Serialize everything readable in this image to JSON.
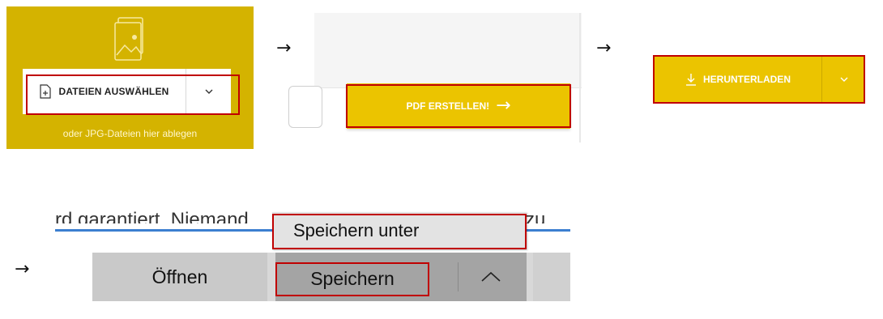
{
  "arrows": {
    "symbol": "→"
  },
  "panel1": {
    "select_button_label": "DATEIEN AUSWÄHLEN",
    "dropzone_hint": "oder JPG-Dateien hier ablegen",
    "icons": [
      "image-icon",
      "file-plus-icon",
      "chevron-down-icon"
    ],
    "colors": {
      "background": "#d4b300",
      "highlight": "#c00000"
    }
  },
  "panel2": {
    "create_pdf_label": "PDF ERSTELLEN!",
    "arrow_glyph": "→",
    "colors": {
      "button": "#ebc400"
    }
  },
  "panel3": {
    "download_label": "HERUNTERLADEN",
    "icons": [
      "download-icon",
      "chevron-down-icon"
    ]
  },
  "panel4": {
    "background_text": "rd garantiert. Niemand",
    "background_text_right": "zu",
    "menu_item": "Speichern unter",
    "open_label": "Öffnen",
    "save_label": "Speichern"
  }
}
